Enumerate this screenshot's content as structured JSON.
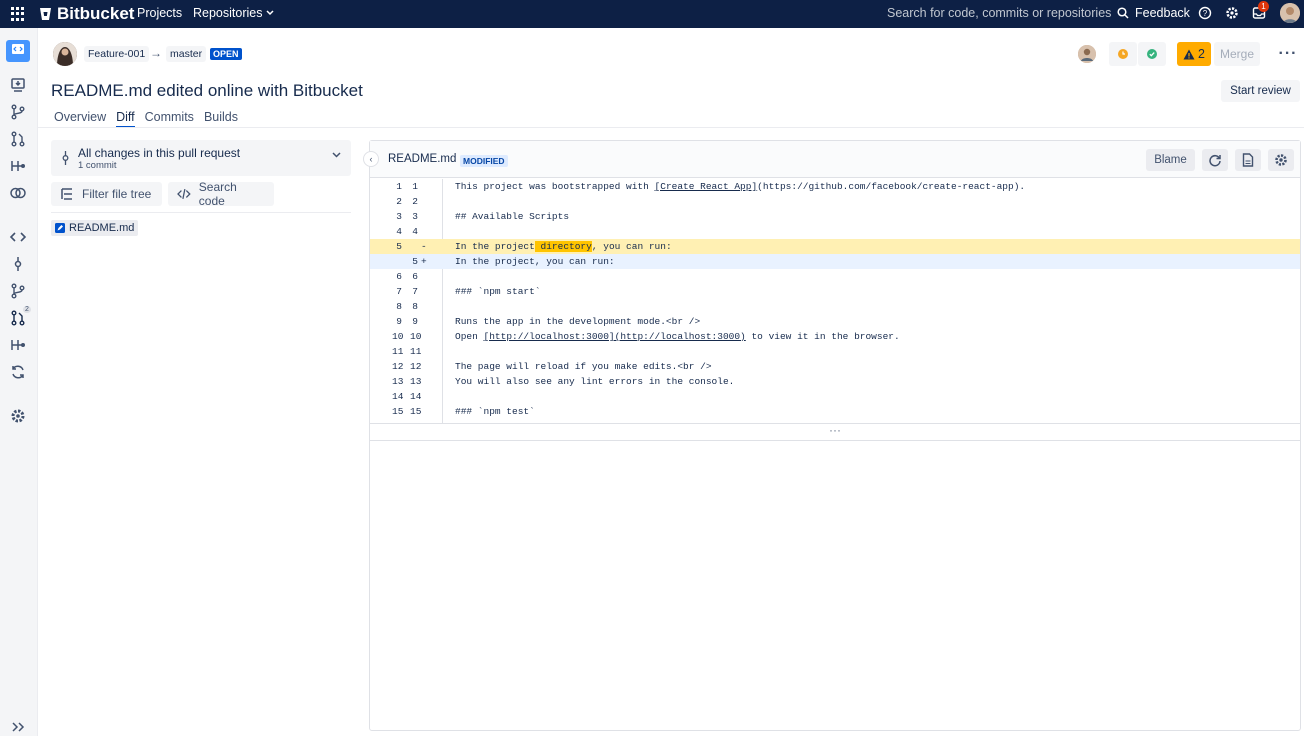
{
  "topnav": {
    "brand": "Bitbucket",
    "projects": "Projects",
    "repositories": "Repositories",
    "search_placeholder": "Search for code, commits or repositories",
    "feedback": "Feedback",
    "notification_count": "1"
  },
  "sidebar": {
    "pull_request_badge": "2"
  },
  "pr": {
    "source_branch": "Feature-001",
    "target_branch": "master",
    "state": "OPEN",
    "title": "README.md edited online with Bitbucket",
    "tabs": [
      "Overview",
      "Diff",
      "Commits",
      "Builds"
    ],
    "selected_tab": "Diff",
    "warnings_count": "2",
    "merge_label": "Merge",
    "start_review_label": "Start review",
    "build_status_colors": {
      "in_progress": "#f5a623",
      "success": "#36b37e"
    }
  },
  "files": {
    "changes_title": "All changes in this pull request",
    "changes_sub": "1 commit",
    "filter_label": "Filter file tree",
    "search_label": "Search code",
    "items": [
      "README.md"
    ]
  },
  "diff": {
    "filename": "README.md",
    "status": "MODIFIED",
    "blame_label": "Blame",
    "expander": "···",
    "lines": [
      {
        "old": "1",
        "new": "1",
        "marker": "",
        "type": "ctx",
        "pre": "This project was bootstrapped with ",
        "link": "[Create React App]",
        "post": "(https://github.com/facebook/create-react-app)."
      },
      {
        "old": "2",
        "new": "2",
        "marker": "",
        "type": "ctx",
        "pre": "",
        "link": "",
        "post": ""
      },
      {
        "old": "3",
        "new": "3",
        "marker": "",
        "type": "ctx",
        "pre": "## Available Scripts",
        "link": "",
        "post": ""
      },
      {
        "old": "4",
        "new": "4",
        "marker": "",
        "type": "ctx",
        "pre": "",
        "link": "",
        "post": ""
      },
      {
        "old": "5",
        "new": "",
        "marker": "-",
        "type": "del",
        "pre": "In the project",
        "hl": " directory",
        "post": ", you can run:"
      },
      {
        "old": "",
        "new": "5",
        "marker": "+",
        "type": "add",
        "pre": "In the project, you can run:",
        "link": "",
        "post": ""
      },
      {
        "old": "6",
        "new": "6",
        "marker": "",
        "type": "ctx",
        "pre": "",
        "link": "",
        "post": ""
      },
      {
        "old": "7",
        "new": "7",
        "marker": "",
        "type": "ctx",
        "pre": "### `npm start`",
        "link": "",
        "post": ""
      },
      {
        "old": "8",
        "new": "8",
        "marker": "",
        "type": "ctx",
        "pre": "",
        "link": "",
        "post": ""
      },
      {
        "old": "9",
        "new": "9",
        "marker": "",
        "type": "ctx",
        "pre": "Runs the app in the development mode.<br />",
        "link": "",
        "post": ""
      },
      {
        "old": "10",
        "new": "10",
        "marker": "",
        "type": "ctx",
        "pre": "Open ",
        "link": "[http://localhost:3000](http://localhost:3000)",
        "post": " to view it in the browser."
      },
      {
        "old": "11",
        "new": "11",
        "marker": "",
        "type": "ctx",
        "pre": "",
        "link": "",
        "post": ""
      },
      {
        "old": "12",
        "new": "12",
        "marker": "",
        "type": "ctx",
        "pre": "The page will reload if you make edits.<br />",
        "link": "",
        "post": ""
      },
      {
        "old": "13",
        "new": "13",
        "marker": "",
        "type": "ctx",
        "pre": "You will also see any lint errors in the console.",
        "link": "",
        "post": ""
      },
      {
        "old": "14",
        "new": "14",
        "marker": "",
        "type": "ctx",
        "pre": "",
        "link": "",
        "post": ""
      },
      {
        "old": "15",
        "new": "15",
        "marker": "",
        "type": "ctx",
        "pre": "### `npm test`",
        "link": "",
        "post": ""
      }
    ]
  }
}
